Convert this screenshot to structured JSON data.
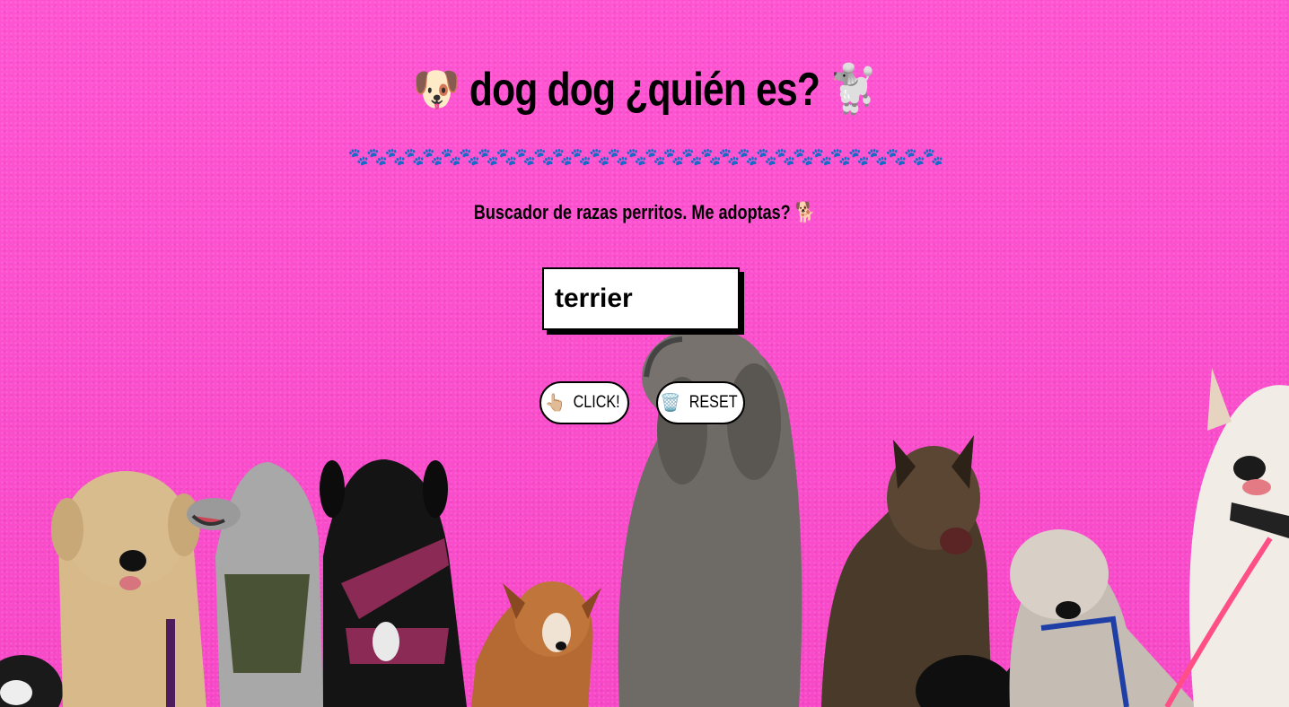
{
  "header": {
    "title": "🐶 dog dog ¿quién es? 🐩",
    "paws": "🐾🐾🐾🐾🐾🐾🐾🐾🐾🐾🐾🐾🐾🐾🐾🐾🐾🐾🐾🐾🐾🐾🐾🐾🐾🐾🐾🐾🐾🐾🐾🐾",
    "subtitle": "Buscador de razas perritos. Me adoptas? 🐕"
  },
  "search": {
    "value": "terrier"
  },
  "buttons": {
    "click_icon": "👆🏼",
    "click_label": "CLICK!",
    "reset_icon": "🗑️",
    "reset_label": "RESET"
  },
  "colors": {
    "background": "#ff4fd0",
    "input_bg": "#ffffff",
    "border": "#000000"
  }
}
